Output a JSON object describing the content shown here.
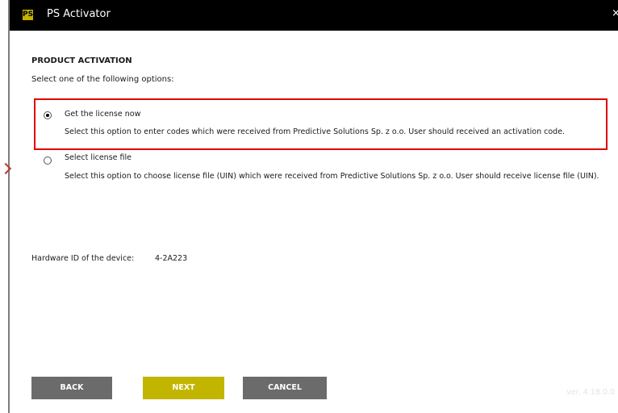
{
  "window": {
    "title": "PS Activator",
    "logo_text": "PS",
    "close_label": "×"
  },
  "main": {
    "section_title": "PRODUCT ACTIVATION",
    "instruction": "Select one of the following options:",
    "options": [
      {
        "title": "Get the license now",
        "description": "Select this option to enter codes which were received from Predictive Solutions Sp. z o.o. User should received an activation code.",
        "selected": true
      },
      {
        "title": "Select license file",
        "description": "Select this option to choose license file (UIN) which were received from Predictive Solutions Sp. z o.o. User should receive license file (UIN).",
        "selected": false
      }
    ],
    "hardware_label": "Hardware ID of the device:",
    "hardware_value": "4-2A223"
  },
  "footer": {
    "back_label": "BACK",
    "next_label": "NEXT",
    "cancel_label": "CANCEL",
    "version": "ver. 4.18.0.0"
  },
  "colors": {
    "titlebar": "#000000",
    "accent": "#c2b500",
    "button_gray": "#6b6b6b",
    "highlight": "#e00000"
  }
}
